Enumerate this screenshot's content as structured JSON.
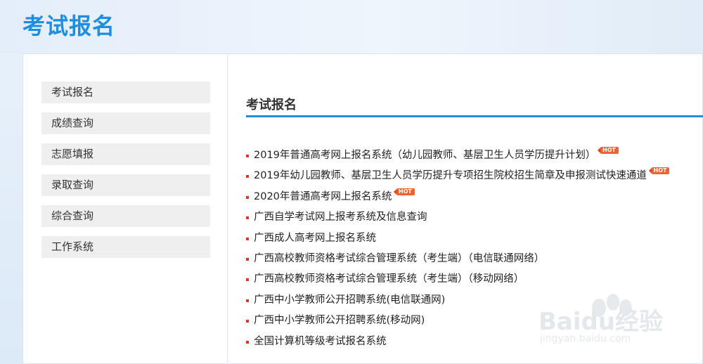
{
  "header": {
    "title": "考试报名"
  },
  "sidebar": {
    "items": [
      {
        "label": "考试报名"
      },
      {
        "label": "成绩查询"
      },
      {
        "label": "志愿填报"
      },
      {
        "label": "录取查询"
      },
      {
        "label": "综合查询"
      },
      {
        "label": "工作系统"
      }
    ]
  },
  "main": {
    "section_title": "考试报名",
    "hot_label": "HOT",
    "links": [
      {
        "text": "2019年普通高考网上报名系统（幼儿园教师、基层卫生人员学历提升计划）",
        "hot": true
      },
      {
        "text": "2019年幼儿园教师、基层卫生人员学历提升专项招生院校招生简章及申报测试快速通道",
        "hot": true
      },
      {
        "text": "2020年普通高考网上报名系统",
        "hot": true
      },
      {
        "text": "广西自学考试网上报考系统及信息查询",
        "hot": false
      },
      {
        "text": "广西成人高考网上报名系统",
        "hot": false
      },
      {
        "text": "广西高校教师资格考试综合管理系统（考生端）（电信联通网络）",
        "hot": false
      },
      {
        "text": "广西高校教师资格考试综合管理系统（考生端）（移动网络）",
        "hot": false
      },
      {
        "text": "广西中小学教师公开招聘系统(电信联通网)",
        "hot": false
      },
      {
        "text": "广西中小学教师公开招聘系统(移动网)",
        "hot": false
      },
      {
        "text": "全国计算机等级考试报名系统",
        "hot": false
      }
    ]
  },
  "watermark": {
    "brand": "Baidu经验",
    "url": "jingyan.baidu.com"
  }
}
